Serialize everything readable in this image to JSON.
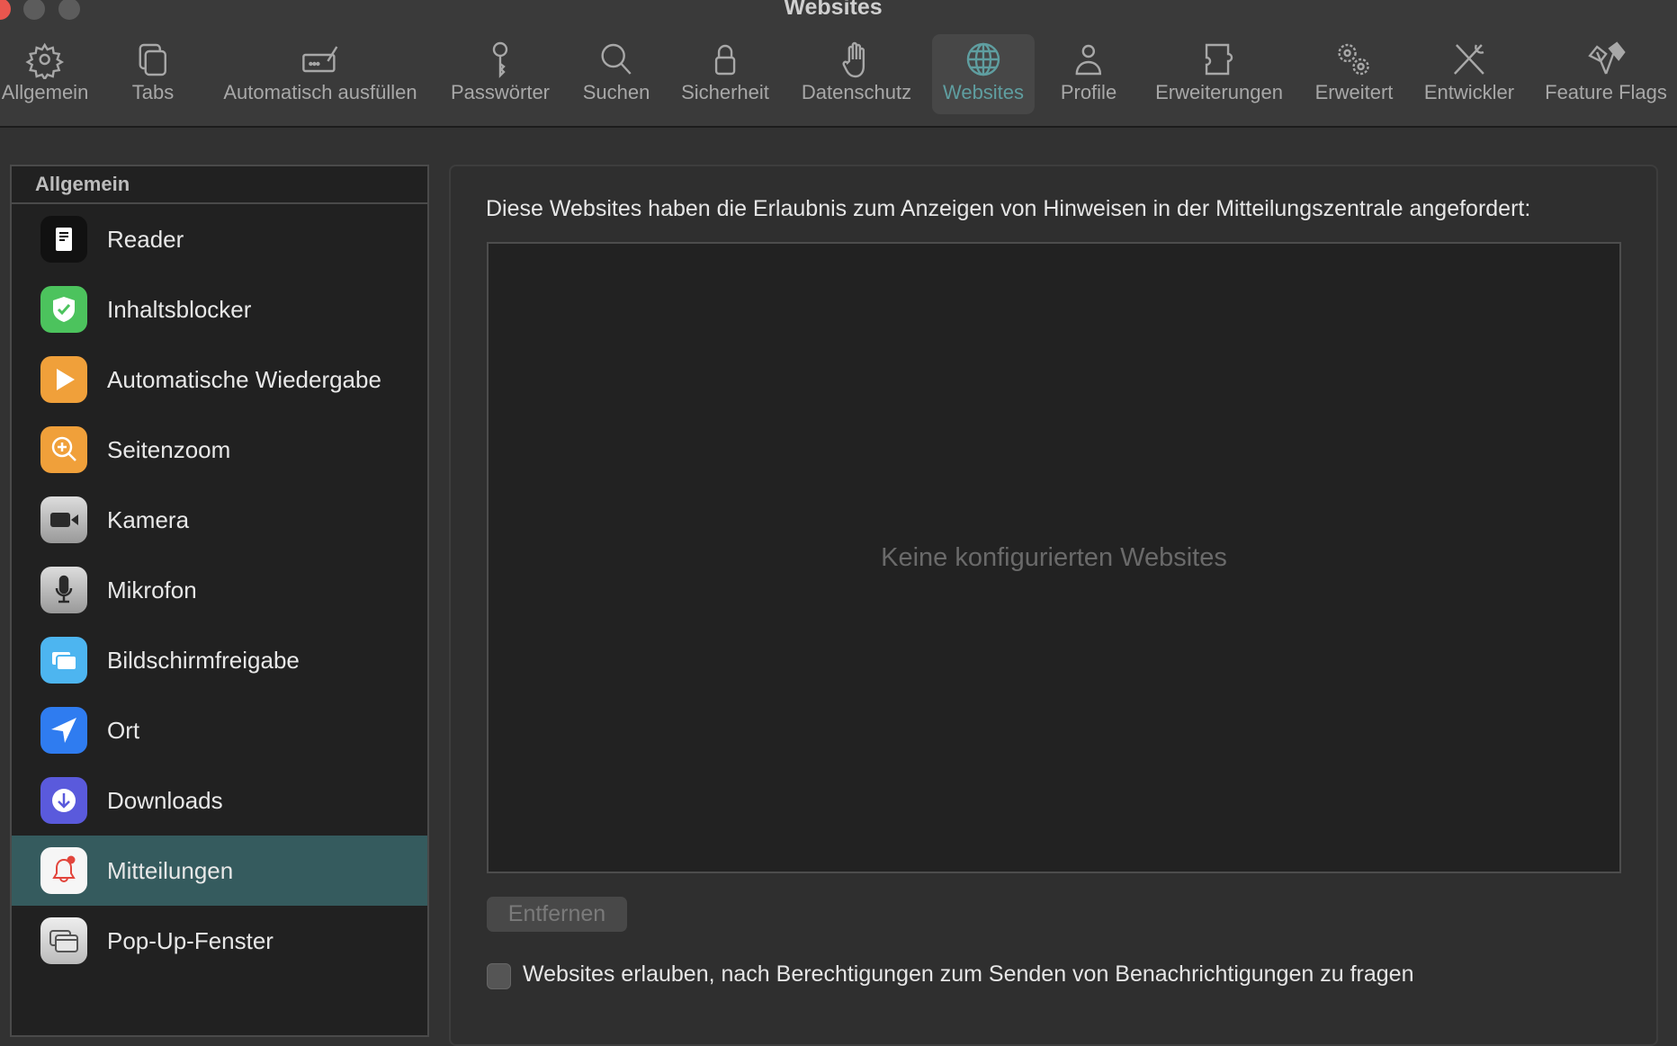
{
  "window": {
    "title": "Websites"
  },
  "toolbar": [
    {
      "label": "Allgemein",
      "icon": "gear-icon"
    },
    {
      "label": "Tabs",
      "icon": "tabs-icon"
    },
    {
      "label": "Automatisch ausfüllen",
      "icon": "autofill-icon"
    },
    {
      "label": "Passwörter",
      "icon": "key-icon"
    },
    {
      "label": "Suchen",
      "icon": "search-icon"
    },
    {
      "label": "Sicherheit",
      "icon": "lock-icon"
    },
    {
      "label": "Datenschutz",
      "icon": "hand-icon"
    },
    {
      "label": "Websites",
      "icon": "globe-icon",
      "active": true
    },
    {
      "label": "Profile",
      "icon": "person-icon"
    },
    {
      "label": "Erweiterungen",
      "icon": "puzzle-icon"
    },
    {
      "label": "Erweitert",
      "icon": "gears-icon"
    },
    {
      "label": "Entwickler",
      "icon": "tools-icon"
    },
    {
      "label": "Feature Flags",
      "icon": "flags-icon"
    }
  ],
  "sidebar": {
    "header": "Allgemein",
    "items": [
      {
        "label": "Reader"
      },
      {
        "label": "Inhaltsblocker"
      },
      {
        "label": "Automatische Wiedergabe"
      },
      {
        "label": "Seitenzoom"
      },
      {
        "label": "Kamera"
      },
      {
        "label": "Mikrofon"
      },
      {
        "label": "Bildschirmfreigabe"
      },
      {
        "label": "Ort"
      },
      {
        "label": "Downloads"
      },
      {
        "label": "Mitteilungen",
        "selected": true
      },
      {
        "label": "Pop-Up-Fenster"
      }
    ]
  },
  "main": {
    "description": "Diese Websites haben die Erlaubnis zum Anzeigen von Hinweisen in der Mitteilungszentrale angefordert:",
    "empty_text": "Keine konfigurierten Websites",
    "remove_button": "Entfernen",
    "checkbox_label": "Websites erlauben, nach Berechtigungen zum Senden von Benachrichtigungen zu fragen",
    "checkbox_checked": false
  },
  "colors": {
    "accent": "#5f9ea0",
    "selection": "#355b5e"
  }
}
